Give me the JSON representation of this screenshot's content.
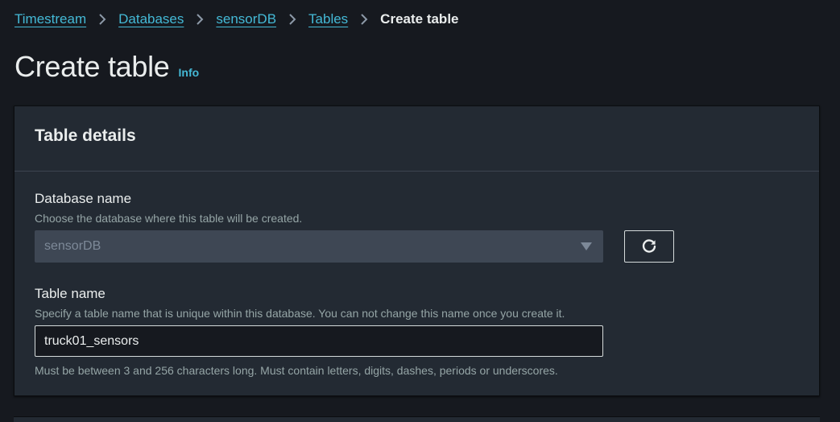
{
  "breadcrumb": {
    "items": [
      {
        "label": "Timestream"
      },
      {
        "label": "Databases"
      },
      {
        "label": "sensorDB"
      },
      {
        "label": "Tables"
      }
    ],
    "current": "Create table",
    "separator_icon": "chevron-right-icon"
  },
  "page": {
    "title": "Create table",
    "info_label": "Info"
  },
  "table_details": {
    "title": "Table details",
    "database": {
      "label": "Database name",
      "description": "Choose the database where this table will be created.",
      "selected_value": "sensorDB",
      "state": "disabled",
      "dropdown_icon": "caret-down-icon",
      "refresh_icon": "refresh-icon"
    },
    "table_name": {
      "label": "Table name",
      "description": "Specify a table name that is unique within this database. You can not change this name once you create it.",
      "value": "truck01_sensors",
      "constraint": "Must be between 3 and 256 characters long. Must contain letters, digits, dashes, periods or underscores."
    }
  },
  "colors": {
    "background": "#16191f",
    "panel": "#232a33",
    "link": "#44b9d6",
    "text": "#eaeded",
    "muted_text": "#95a5a6"
  }
}
